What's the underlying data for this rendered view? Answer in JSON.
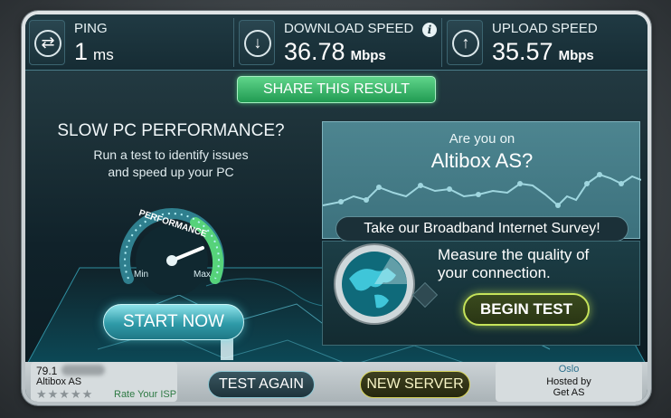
{
  "results": {
    "ping": {
      "label": "PING",
      "value": "1",
      "unit": "ms"
    },
    "download": {
      "label": "DOWNLOAD SPEED",
      "value": "36.78",
      "unit": "Mbps"
    },
    "upload": {
      "label": "UPLOAD SPEED",
      "value": "35.57",
      "unit": "Mbps"
    }
  },
  "share_label": "SHARE THIS RESULT",
  "promo": {
    "title": "SLOW PC PERFORMANCE?",
    "subtitle_line1": "Run a test to identify issues",
    "subtitle_line2": "and speed up your PC",
    "gauge_label": "PERFORMANCE",
    "gauge_min": "Min",
    "gauge_max": "Max",
    "start_label": "START NOW"
  },
  "survey": {
    "question": "Are you on",
    "isp": "Altibox AS?",
    "button": "Take our Broadband Internet Survey!"
  },
  "measure": {
    "line1": "Measure the quality of",
    "line2": "your connection.",
    "button": "BEGIN TEST"
  },
  "bottom": {
    "ip": "79.1",
    "isp_name": "Altibox AS",
    "stars": "★★★★★",
    "rate_label": "Rate Your ISP",
    "test_again": "TEST AGAIN",
    "new_server": "NEW SERVER",
    "server_city": "Oslo",
    "hosted_by": "Hosted by",
    "host": "Get AS"
  },
  "colors": {
    "accent_green": "#2fb765",
    "accent_teal": "#36a6b4",
    "accent_lime": "#c6e35a"
  }
}
